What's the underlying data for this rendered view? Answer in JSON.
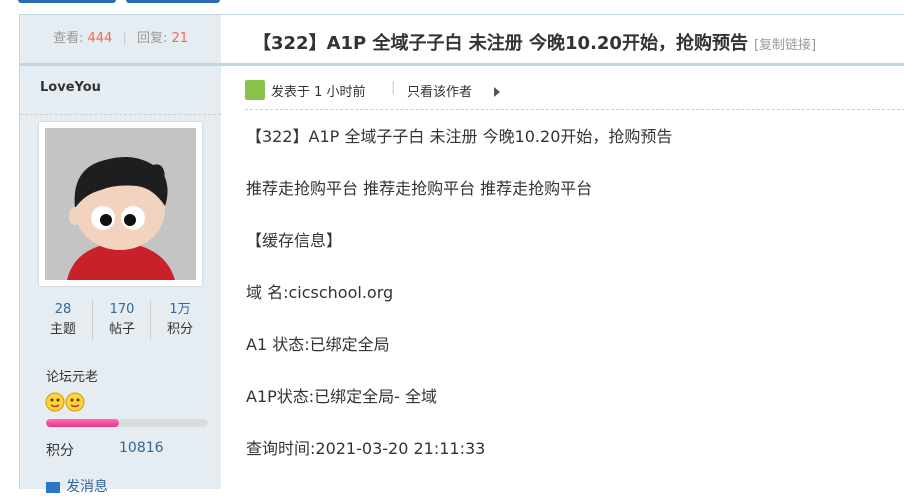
{
  "thread_stats": {
    "views_label": "查看:",
    "views": "444",
    "replies_label": "回复:",
    "replies": "21"
  },
  "thread": {
    "title": "【322】A1P 全域子子白 未注册 今晚10.20开始，抢购预告",
    "copy_link": "[复制链接]"
  },
  "author": {
    "name": "LoveYou",
    "stats": [
      {
        "value": "28",
        "label": "主题"
      },
      {
        "value": "170",
        "label": "帖子"
      },
      {
        "value": "1万",
        "label": "积分"
      }
    ],
    "rank_title": "论坛元老",
    "level_progress": 0.45,
    "points_label": "积分",
    "points_value": "10816",
    "send_message": "发消息"
  },
  "post_meta": {
    "posted": "发表于 1 小时前",
    "only_author": "只看该作者"
  },
  "post_body": [
    "【322】A1P 全域子子白 未注册 今晚10.20开始，抢购预告",
    "推荐走抢购平台 推荐走抢购平台 推荐走抢购平台",
    "【缓存信息】",
    "域 名:cicschool.org",
    "A1  状态:已绑定全局",
    "A1P状态:已绑定全局- 全域",
    "查询时间:2021-03-20 21:11:33"
  ],
  "colors": {
    "accent_blue": "#336699",
    "count_red": "#f26c4f",
    "progress_pink": "#e8358f",
    "border_blue": "#c2d5e3",
    "sidebar_bg": "#e5edf2"
  }
}
